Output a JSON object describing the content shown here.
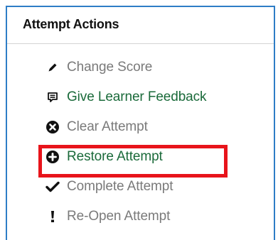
{
  "panel": {
    "title": "Attempt Actions"
  },
  "actions": [
    {
      "label": "Change Score",
      "icon": "pencil-icon",
      "state": "disabled"
    },
    {
      "label": "Give Learner Feedback",
      "icon": "comment-icon",
      "state": "enabled"
    },
    {
      "label": "Clear Attempt",
      "icon": "remove-circle-icon",
      "state": "disabled"
    },
    {
      "label": "Restore Attempt",
      "icon": "plus-circle-icon",
      "state": "enabled",
      "highlighted": true
    },
    {
      "label": "Complete Attempt",
      "icon": "checkmark-icon",
      "state": "disabled"
    },
    {
      "label": "Re-Open Attempt",
      "icon": "exclamation-icon",
      "state": "disabled"
    }
  ],
  "colors": {
    "panel_border": "#2e7dc6",
    "enabled_text": "#1a6a3a",
    "disabled_text": "#7a7a7a",
    "highlight": "#e8141b"
  }
}
